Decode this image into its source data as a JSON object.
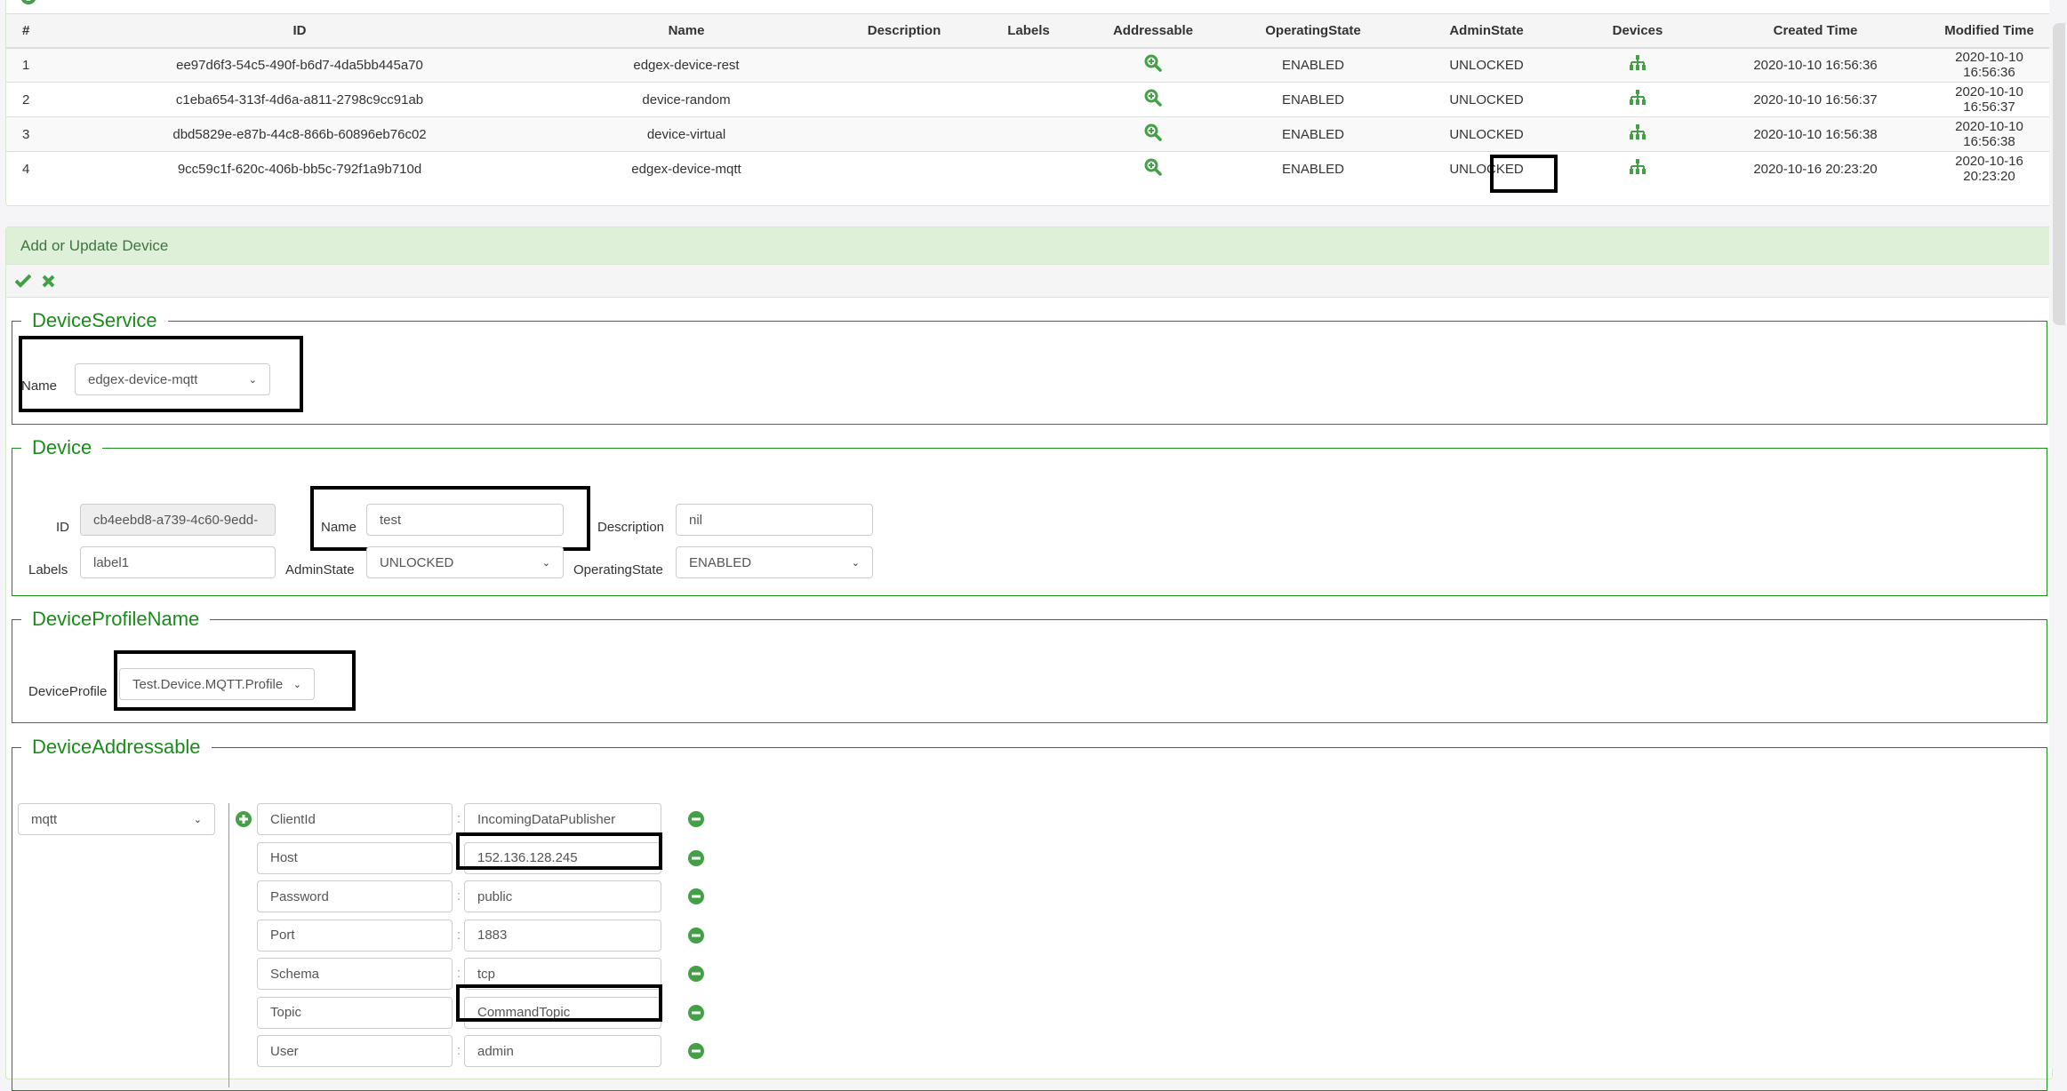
{
  "device_services_table": {
    "columns": [
      "#",
      "ID",
      "Name",
      "Description",
      "Labels",
      "Addressable",
      "OperatingState",
      "AdminState",
      "Devices",
      "Created Time",
      "Modified Time"
    ],
    "rows": [
      {
        "num": "1",
        "id": "ee97d6f3-54c5-490f-b6d7-4da5bb445a70",
        "name": "edgex-device-rest",
        "description": "",
        "labels": "",
        "operating_state": "ENABLED",
        "admin_state": "UNLOCKED",
        "created": "2020-10-10 16:56:36",
        "modified": "2020-10-10 16:56:36"
      },
      {
        "num": "2",
        "id": "c1eba654-313f-4d6a-a811-2798c9cc91ab",
        "name": "device-random",
        "description": "",
        "labels": "",
        "operating_state": "ENABLED",
        "admin_state": "UNLOCKED",
        "created": "2020-10-10 16:56:37",
        "modified": "2020-10-10 16:56:37"
      },
      {
        "num": "3",
        "id": "dbd5829e-e87b-44c8-866b-60896eb76c02",
        "name": "device-virtual",
        "description": "",
        "labels": "",
        "operating_state": "ENABLED",
        "admin_state": "UNLOCKED",
        "created": "2020-10-10 16:56:38",
        "modified": "2020-10-10 16:56:38"
      },
      {
        "num": "4",
        "id": "9cc59c1f-620c-406b-bb5c-792f1a9b710d",
        "name": "edgex-device-mqtt",
        "description": "",
        "labels": "",
        "operating_state": "ENABLED",
        "admin_state": "UNLOCKED",
        "created": "2020-10-16 20:23:20",
        "modified": "2020-10-16 20:23:20"
      }
    ],
    "icons": {
      "refresh": "refresh-icon",
      "addressable": "zoom-in-icon",
      "devices": "sitemap-icon"
    }
  },
  "form": {
    "heading": "Add or Update Device",
    "toolbar": {
      "confirm_icon": "check-icon",
      "cancel_icon": "times-icon"
    },
    "device_service": {
      "legend": "DeviceService",
      "name_label": "Name",
      "name_value": "edgex-device-mqtt"
    },
    "device": {
      "legend": "Device",
      "id_label": "ID",
      "id_value": "cb4eebd8-a739-4c60-9edd-",
      "name_label": "Name",
      "name_value": "test",
      "description_label": "Description",
      "description_value": "nil",
      "labels_label": "Labels",
      "labels_value": "label1",
      "admin_state_label": "AdminState",
      "admin_state_value": "UNLOCKED",
      "operating_state_label": "OperatingState",
      "operating_state_value": "ENABLED"
    },
    "device_profile": {
      "legend": "DeviceProfileName",
      "label": "DeviceProfile",
      "value": "Test.Device.MQTT.Profile"
    },
    "device_addressable": {
      "legend": "DeviceAddressable",
      "protocol": "mqtt",
      "properties": [
        {
          "key": "ClientId",
          "value": "IncomingDataPublisher"
        },
        {
          "key": "Host",
          "value": "152.136.128.245"
        },
        {
          "key": "Password",
          "value": "public"
        },
        {
          "key": "Port",
          "value": "1883"
        },
        {
          "key": "Schema",
          "value": "tcp"
        },
        {
          "key": "Topic",
          "value": "CommandTopic"
        },
        {
          "key": "User",
          "value": "admin"
        }
      ],
      "separator": ":"
    }
  },
  "colors": {
    "accent_green": "#1a8c1a",
    "icon_green": "#43a047",
    "panel_heading_bg": "#dff0d8",
    "panel_heading_text": "#3c763d"
  }
}
